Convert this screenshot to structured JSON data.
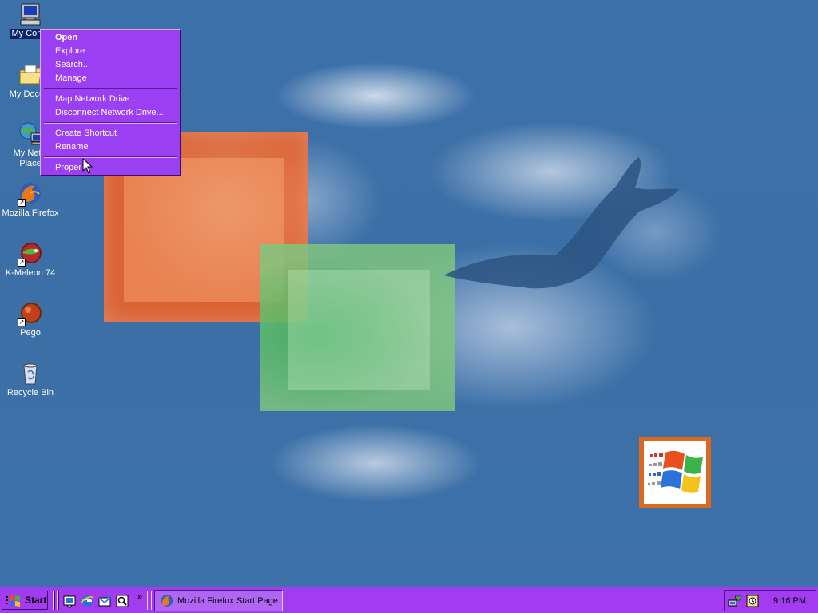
{
  "desktop": {
    "icons": [
      {
        "label": "My Comp",
        "icon": "my-computer-icon"
      },
      {
        "label": "My Docum",
        "icon": "my-documents-icon"
      },
      {
        "label_line1": "My Netw",
        "label_line2": "Place",
        "icon": "network-places-icon"
      },
      {
        "label": "Mozilla Firefox",
        "icon": "firefox-icon"
      },
      {
        "label": "K-Meleon 74",
        "icon": "kmeleon-icon"
      },
      {
        "label": "Pego",
        "icon": "pego-icon"
      },
      {
        "label": "Recycle Bin",
        "icon": "recycle-bin-icon"
      }
    ]
  },
  "context_menu": {
    "items": [
      {
        "label": "Open",
        "default": true
      },
      {
        "label": "Explore"
      },
      {
        "label": "Search..."
      },
      {
        "label": "Manage"
      },
      {
        "label": "Map Network Drive..."
      },
      {
        "label": "Disconnect Network Drive..."
      },
      {
        "label": "Create Shortcut"
      },
      {
        "label": "Rename"
      },
      {
        "label": "Proper"
      }
    ]
  },
  "taskbar": {
    "start_label": "Start",
    "quick_launch": [
      "desktop-icon",
      "ie-icon",
      "outlook-icon",
      "search-icon"
    ],
    "chevron": "»",
    "tasks": [
      {
        "label": "Mozilla Firefox Start Page...",
        "icon": "firefox-icon"
      }
    ],
    "clock": "9:16 PM"
  },
  "colors": {
    "desktop": "#3a6ea5",
    "menu": "#9b3ff3",
    "taskbar": "#a33cf0",
    "selection": "#0a246a"
  }
}
